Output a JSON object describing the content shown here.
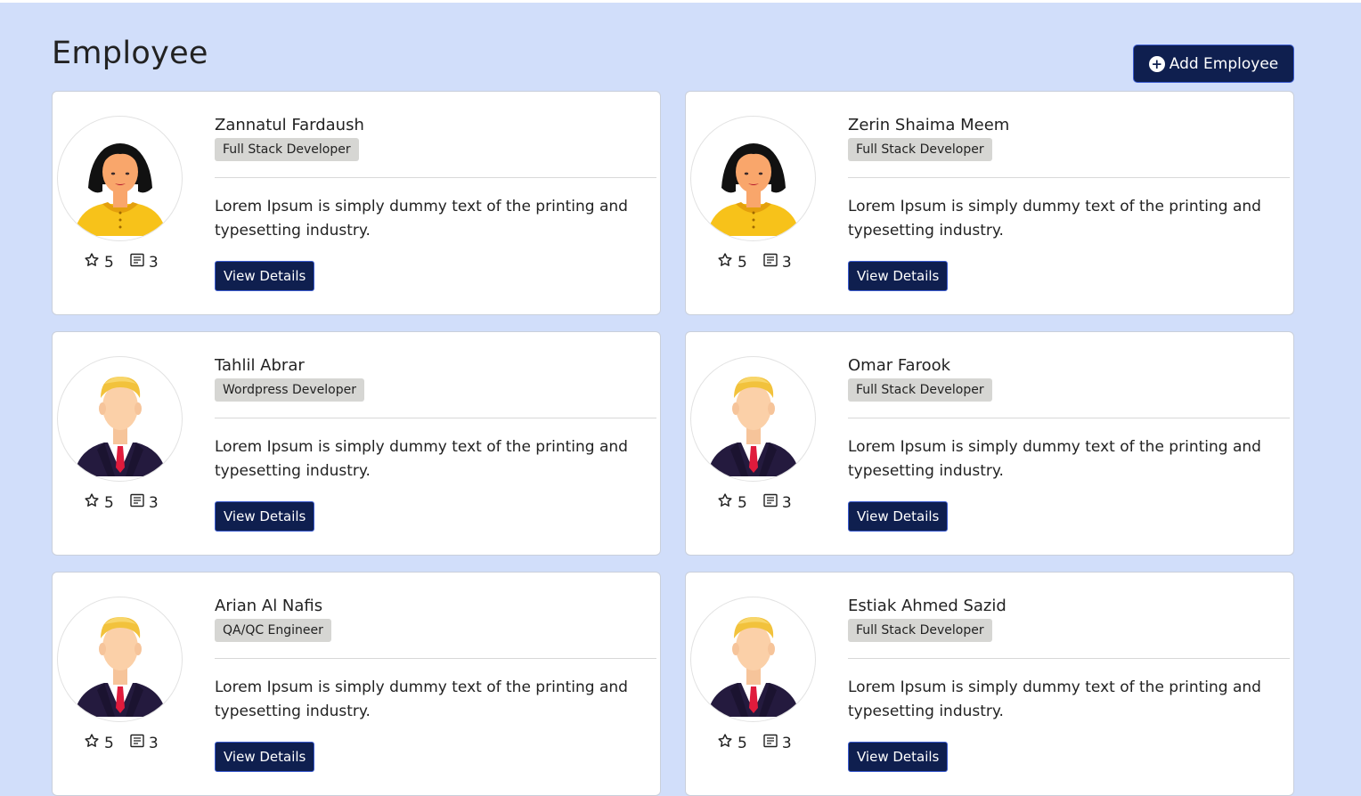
{
  "header": {
    "title": "Employee",
    "add_button": "Add Employee",
    "add_icon": "plus-circle-icon"
  },
  "employees": [
    {
      "name": "Zannatul Fardaush",
      "role": "Full Stack Developer",
      "description": "Lorem Ipsum is simply dummy text of the printing and typesetting industry.",
      "rating": "5",
      "projects": "3",
      "avatar": "female",
      "button": "View Details"
    },
    {
      "name": "Zerin Shaima Meem",
      "role": "Full Stack Developer",
      "description": "Lorem Ipsum is simply dummy text of the printing and typesetting industry.",
      "rating": "5",
      "projects": "3",
      "avatar": "female",
      "button": "View Details"
    },
    {
      "name": "Tahlil Abrar",
      "role": "Wordpress Developer",
      "description": "Lorem Ipsum is simply dummy text of the printing and typesetting industry.",
      "rating": "5",
      "projects": "3",
      "avatar": "male",
      "button": "View Details"
    },
    {
      "name": "Omar Farook",
      "role": "Full Stack Developer",
      "description": "Lorem Ipsum is simply dummy text of the printing and typesetting industry.",
      "rating": "5",
      "projects": "3",
      "avatar": "male",
      "button": "View Details"
    },
    {
      "name": "Arian Al Nafis",
      "role": "QA/QC Engineer",
      "description": "Lorem Ipsum is simply dummy text of the printing and typesetting industry.",
      "rating": "5",
      "projects": "3",
      "avatar": "male",
      "button": "View Details"
    },
    {
      "name": "Estiak Ahmed Sazid",
      "role": "Full Stack Developer",
      "description": "Lorem Ipsum is simply dummy text of the printing and typesetting industry.",
      "rating": "5",
      "projects": "3",
      "avatar": "male",
      "button": "View Details"
    }
  ],
  "icons": {
    "rating": "star-icon",
    "projects": "document-list-icon"
  },
  "colors": {
    "background": "#d1defa",
    "primary_button": "#0f1f4f",
    "badge": "#d6d6d3"
  }
}
